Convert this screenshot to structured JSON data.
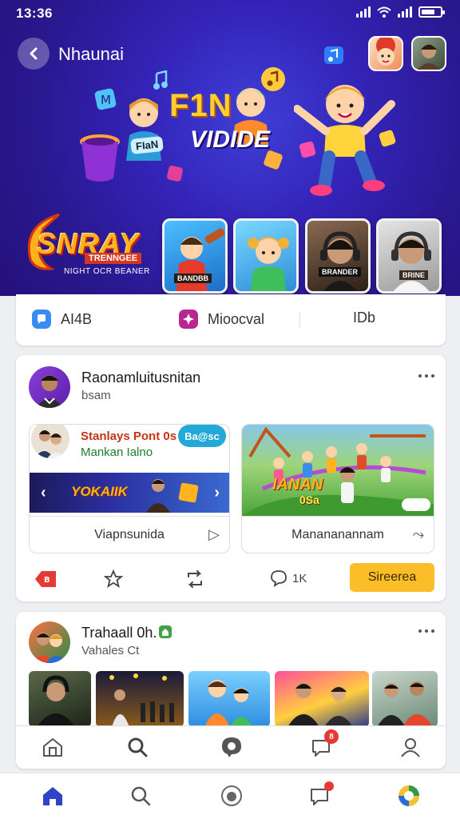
{
  "status_bar": {
    "time": "13:36"
  },
  "hero": {
    "title": "Nhaunai",
    "headline": "F1N",
    "headline_sub": "VIDIDE",
    "pill_label": "FIaN",
    "brand": {
      "name": "SNRAY",
      "badge": "TRENNGEE",
      "tagline": "NIGHT OCR BEANER"
    },
    "thumbnails": [
      {
        "caption": "BANDBB"
      },
      {
        "caption": ""
      },
      {
        "caption": "BRANDER"
      },
      {
        "caption": "BRINE"
      }
    ]
  },
  "tabs": [
    {
      "label": "AI4B",
      "icon": "chat-icon"
    },
    {
      "label": "Mioocval",
      "icon": "spark-icon"
    },
    {
      "label": "IDb"
    }
  ],
  "post1": {
    "author": "Raonamluitusnitan",
    "subtitle": "bsam",
    "sub_left": {
      "title": "Stanlays Pont 0s",
      "subtitle": "Mankan Ialno",
      "badge": "Ba@sc",
      "banner_text": "YOKAIIK",
      "footer_label": "Viapnsunida"
    },
    "sub_right": {
      "overlay_text": "IANAN",
      "overlay_sub": "0Sa",
      "footer_label": "Manananannam"
    },
    "actions": {
      "reply_count": "1K",
      "subscribe_label": "Sireerea"
    }
  },
  "post2": {
    "author": "Trahaall 0h.",
    "subtitle": "Vahales Ct"
  },
  "notifications_badge": "8",
  "colors": {
    "hero_bg": "#2a1890",
    "accent_blue": "#2e43c8",
    "subscribe": "#fbbd28",
    "badge_red": "#e53935"
  }
}
